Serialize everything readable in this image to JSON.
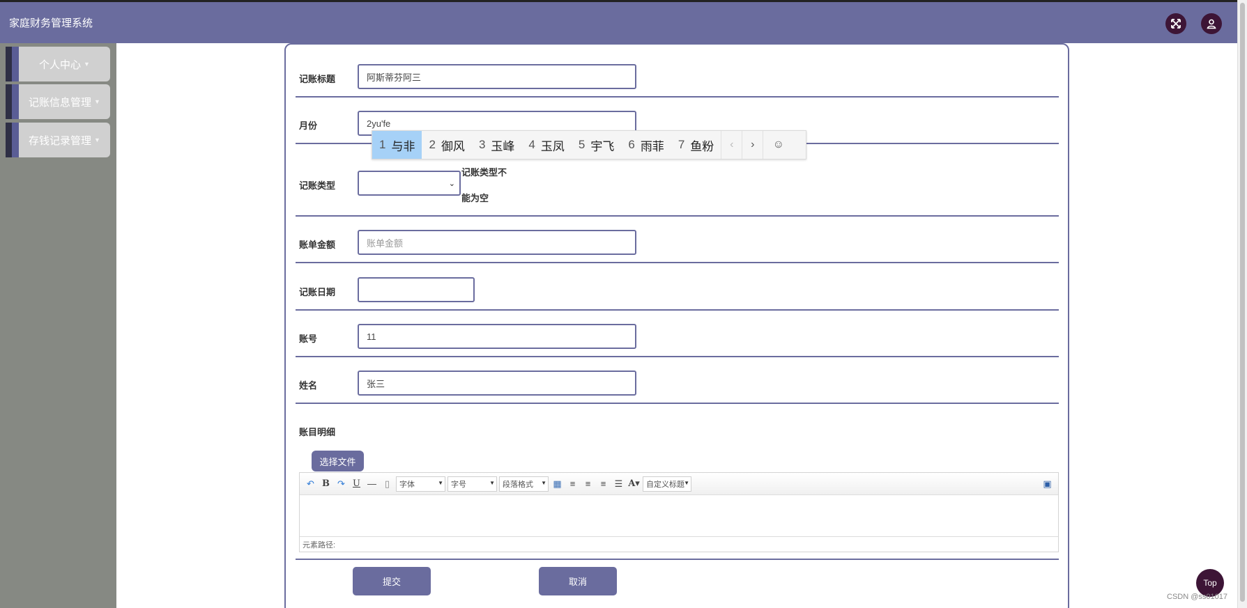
{
  "header": {
    "title": "家庭财务管理系统"
  },
  "sidebar": {
    "items": [
      {
        "label": "个人中心"
      },
      {
        "label": "记账信息管理"
      },
      {
        "label": "存钱记录管理"
      }
    ]
  },
  "form": {
    "title_label": "记账标题",
    "title_value": "阿斯蒂芬阿三",
    "month_label": "月份",
    "month_value": "2yu'fe",
    "type_label": "记账类型",
    "type_error_line1": "记账类型不",
    "type_error_line2": "能为空",
    "amount_label": "账单金额",
    "amount_placeholder": "账单金额",
    "date_label": "记账日期",
    "account_label": "账号",
    "account_value": "11",
    "name_label": "姓名",
    "name_value": "张三",
    "detail_label": "账目明细",
    "upload_label": "选择文件",
    "submit_label": "提交",
    "cancel_label": "取消"
  },
  "ime": {
    "candidates": [
      {
        "num": "1",
        "text": "与非"
      },
      {
        "num": "2",
        "text": "御风"
      },
      {
        "num": "3",
        "text": "玉峰"
      },
      {
        "num": "4",
        "text": "玉凤"
      },
      {
        "num": "5",
        "text": "宇飞"
      },
      {
        "num": "6",
        "text": "雨菲"
      },
      {
        "num": "7",
        "text": "鱼粉"
      }
    ]
  },
  "editor": {
    "font_select": "字体",
    "size_select": "字号",
    "para_select": "段落格式",
    "custom_title_select": "自定义标题",
    "path_label": "元素路径:"
  },
  "misc": {
    "top_label": "Top",
    "watermark": "CSDN @ss01017"
  },
  "colors": {
    "accent": "#6a6c9e",
    "dark_button": "#3d1536",
    "sidebar_bg": "#868983"
  }
}
